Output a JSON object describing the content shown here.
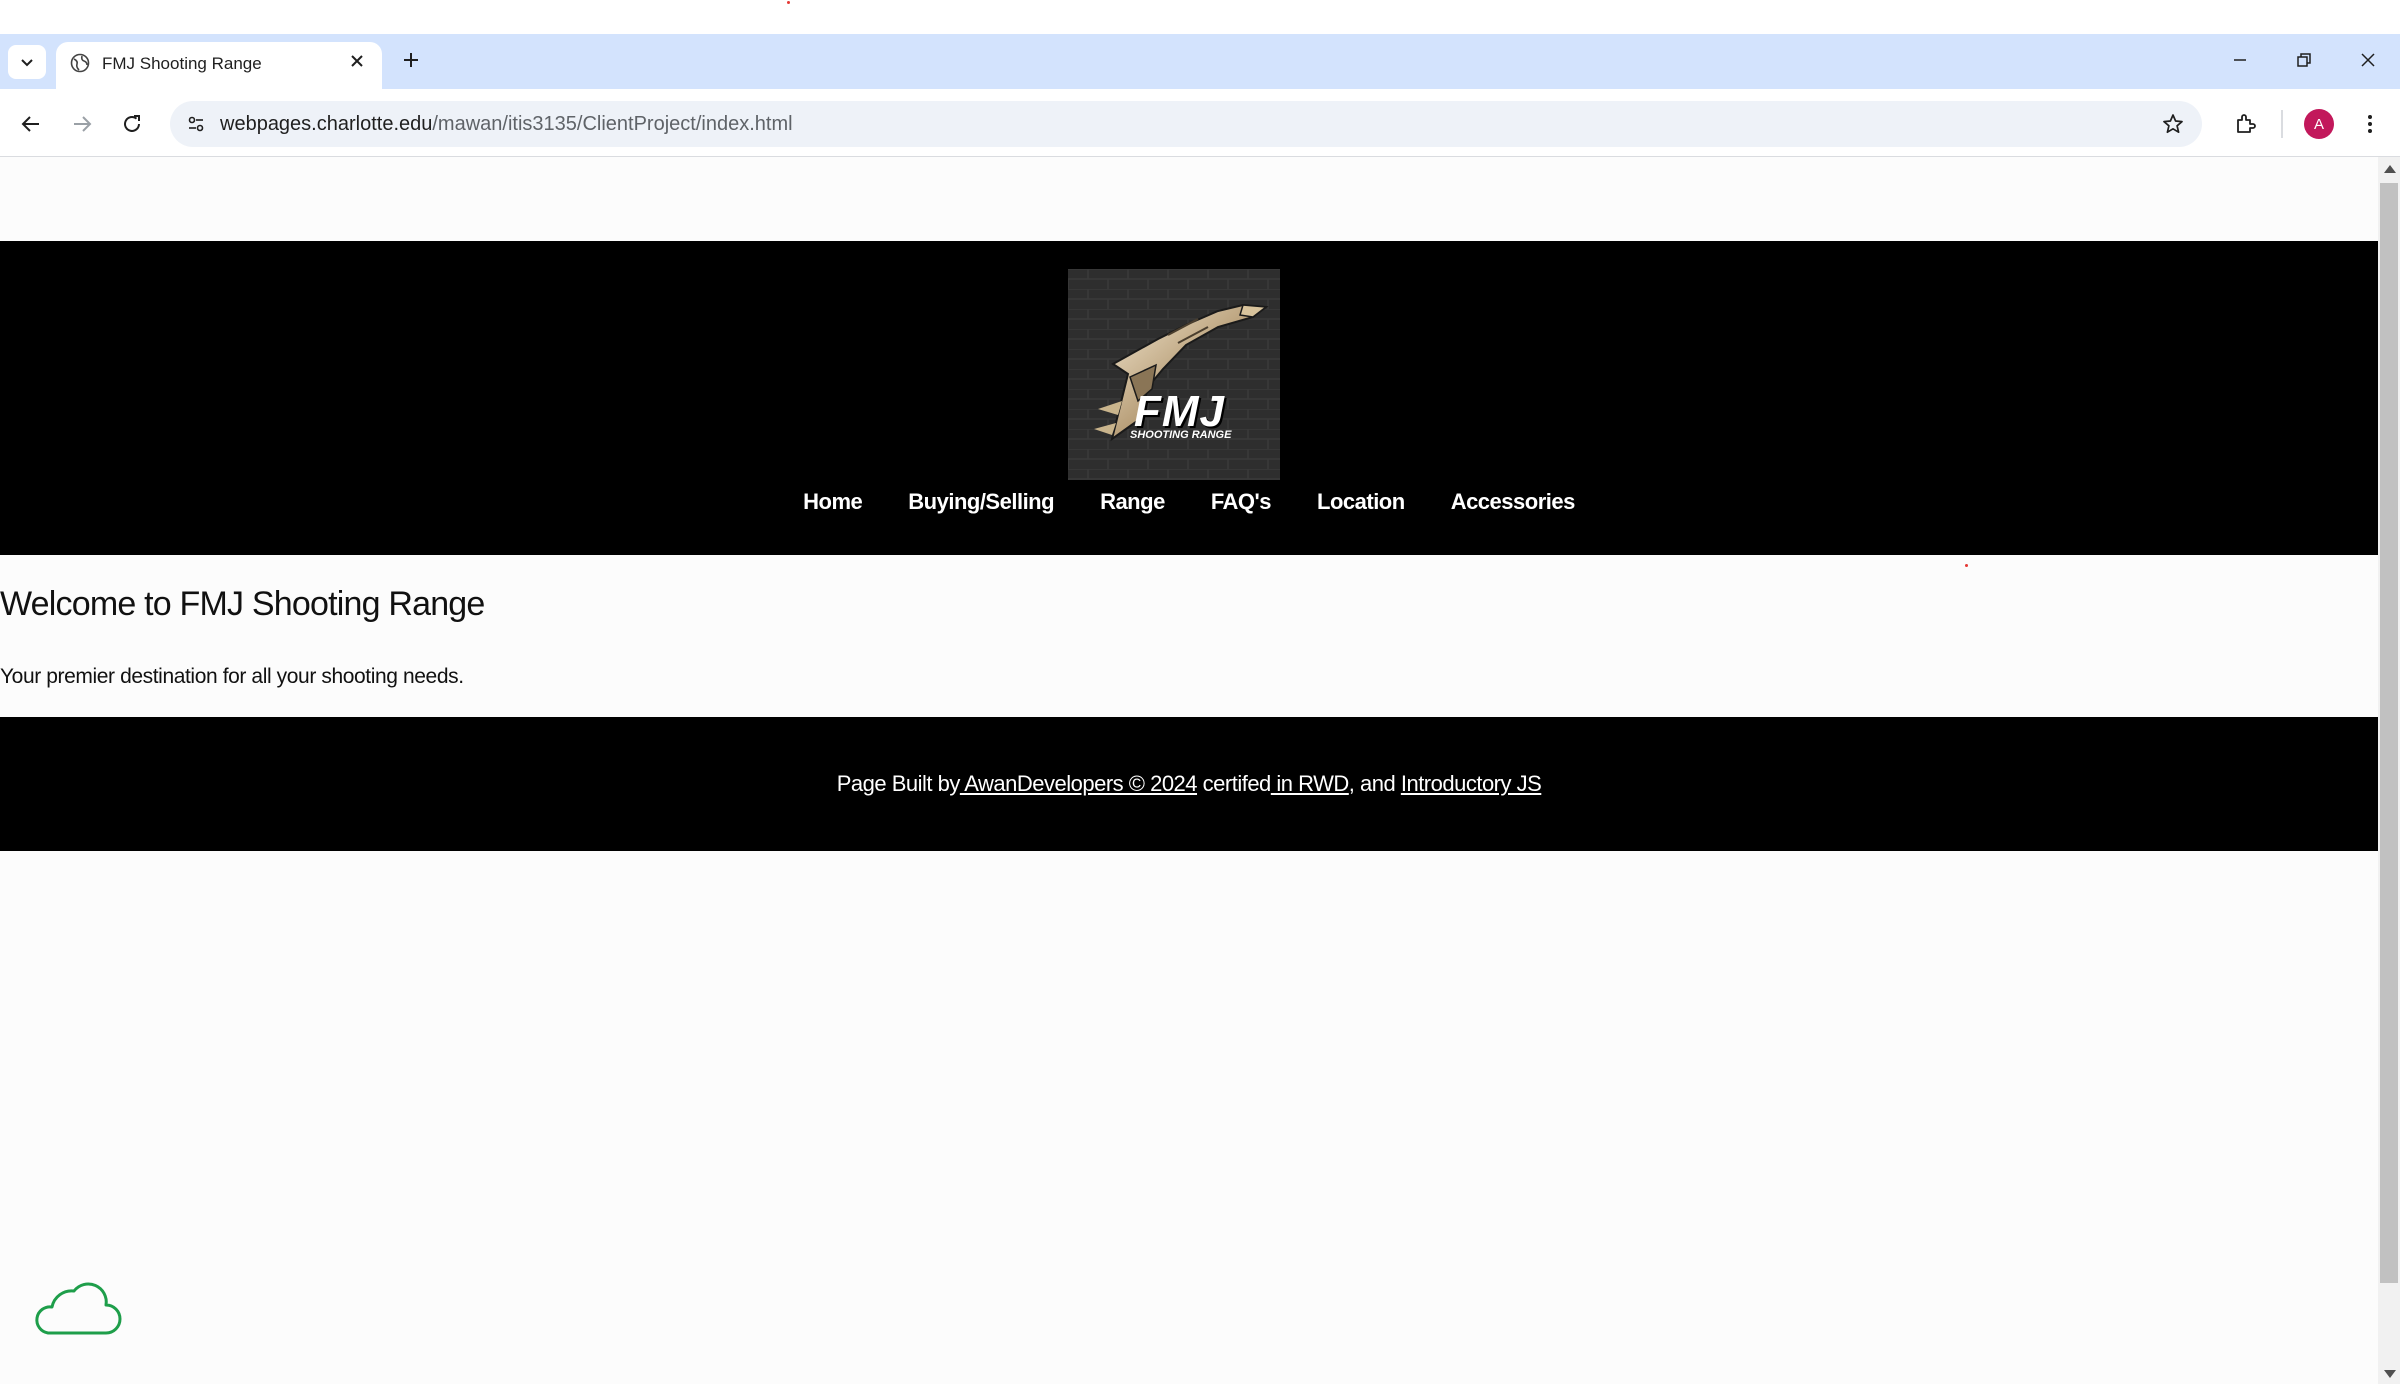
{
  "browser": {
    "tab_title": "FMJ Shooting Range",
    "url_domain": "webpages.charlotte.edu",
    "url_path": "/mawan/itis3135/ClientProject/index.html",
    "profile_initial": "A",
    "icons": [
      "tab-list-icon",
      "globe-icon",
      "close-icon",
      "plus-icon",
      "minimize-icon",
      "restore-icon",
      "window-close-icon",
      "back-icon",
      "forward-icon",
      "reload-icon",
      "site-info-icon",
      "star-icon",
      "extensions-icon",
      "more-icon"
    ]
  },
  "site": {
    "logo": {
      "main": "FMJ",
      "sub": "SHOOTING RANGE"
    },
    "nav": [
      "Home",
      "Buying/Selling",
      "Range",
      "FAQ's",
      "Location",
      "Accessories"
    ],
    "heading": "Welcome to FMJ Shooting Range",
    "tagline": "Your premier destination for all your shooting needs.",
    "footer": {
      "prefix": "Page Built by",
      "link_author": " AwanDevelopers © 2024",
      "middle": " certifed",
      "link_rwd": " in RWD",
      "separator": ", and ",
      "link_js": "Introductory JS"
    }
  },
  "colors": {
    "header_bg": "#000000",
    "page_bg": "#fcfcfc",
    "tabbar_bg": "#d3e3fd",
    "cloud_stroke": "#1e9e4a",
    "avatar_bg": "#c2185b"
  }
}
